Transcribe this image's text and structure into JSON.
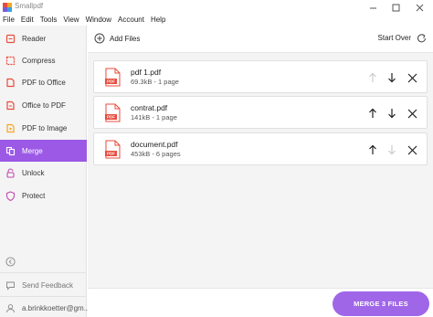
{
  "app": {
    "title": "Smallpdf",
    "logo_colors": [
      "#e84b3c",
      "#f4a623",
      "#7b5bd6",
      "#3aa0e0"
    ]
  },
  "menu": [
    "File",
    "Edit",
    "Tools",
    "View",
    "Window",
    "Account",
    "Help"
  ],
  "sidebar": {
    "items": [
      {
        "label": "Reader",
        "icon": "reader-icon",
        "color": "#e84b3c"
      },
      {
        "label": "Compress",
        "icon": "compress-icon",
        "color": "#e84b3c"
      },
      {
        "label": "PDF to Office",
        "icon": "pdf-to-office-icon",
        "color": "#e84b3c"
      },
      {
        "label": "Office to PDF",
        "icon": "office-to-pdf-icon",
        "color": "#e84b3c"
      },
      {
        "label": "PDF to Image",
        "icon": "pdf-to-image-icon",
        "color": "#f4a623"
      },
      {
        "label": "Merge",
        "icon": "merge-icon",
        "color": "#ffffff",
        "active": true
      },
      {
        "label": "Unlock",
        "icon": "unlock-icon",
        "color": "#c04ab0"
      },
      {
        "label": "Protect",
        "icon": "protect-icon",
        "color": "#c04ab0"
      }
    ],
    "feedback": "Send Feedback",
    "account": "a.brinkkoetter@gm..."
  },
  "toolbar": {
    "add_files": "Add Files",
    "start_over": "Start Over"
  },
  "files": [
    {
      "name": "pdf 1.pdf",
      "meta": "69.3kB - 1 page",
      "up_enabled": false,
      "down_enabled": true
    },
    {
      "name": "contrat.pdf",
      "meta": "141kB - 1 page",
      "up_enabled": true,
      "down_enabled": true
    },
    {
      "name": "document.pdf",
      "meta": "453kB - 6 pages",
      "up_enabled": true,
      "down_enabled": false
    }
  ],
  "pdf_badge": "PDF",
  "merge_button": "MERGE 3 FILES",
  "colors": {
    "accent": "#9b59e6",
    "merge_button": "#a066e8",
    "pdf_red": "#e84b3c"
  }
}
